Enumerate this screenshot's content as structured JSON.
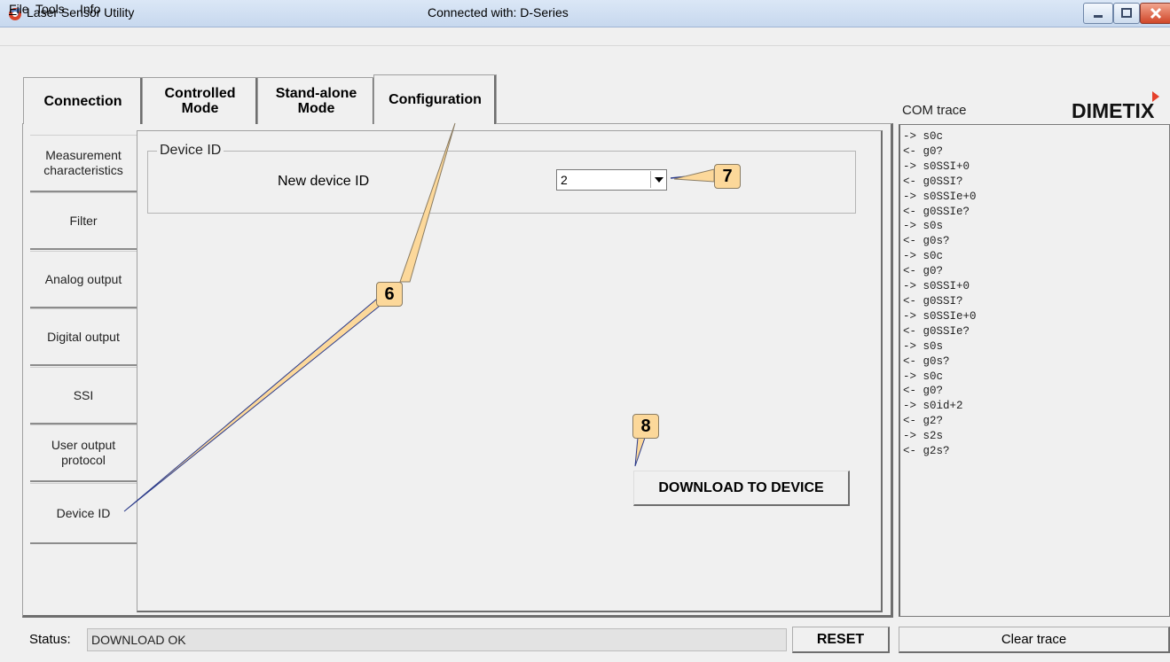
{
  "window": {
    "title": "Laser Sensor Utility",
    "connection_title": "Connected with: D-Series"
  },
  "menu": {
    "items": [
      "File",
      "Tools",
      "Info"
    ]
  },
  "tabs": [
    {
      "label_line1": "Connection",
      "label_line2": ""
    },
    {
      "label_line1": "Controlled",
      "label_line2": "Mode"
    },
    {
      "label_line1": "Stand-alone",
      "label_line2": "Mode"
    },
    {
      "label_line1": "Configuration",
      "label_line2": ""
    }
  ],
  "side_tabs": [
    {
      "line1": "Measurement",
      "line2": "characteristics"
    },
    {
      "line1": "Filter",
      "line2": ""
    },
    {
      "line1": "Analog output",
      "line2": ""
    },
    {
      "line1": "Digital output",
      "line2": ""
    },
    {
      "line1": "SSI",
      "line2": ""
    },
    {
      "line1": "User output",
      "line2": "protocol"
    },
    {
      "line1": "Device ID",
      "line2": ""
    }
  ],
  "device_id": {
    "group_title": "Device ID",
    "new_device_label": "New device ID",
    "selected_value": "2"
  },
  "download_button": "DOWNLOAD TO DEVICE",
  "com_trace": {
    "title": "COM trace",
    "logo": "DIMETIX",
    "lines": [
      "-> s0c",
      "<- g0?",
      "-> s0SSI+0",
      "<- g0SSI?",
      "-> s0SSIe+0",
      "<- g0SSIe?",
      "-> s0s",
      "<- g0s?",
      "-> s0c",
      "<- g0?",
      "-> s0SSI+0",
      "<- g0SSI?",
      "-> s0SSIe+0",
      "<- g0SSIe?",
      "-> s0s",
      "<- g0s?",
      "-> s0c",
      "<- g0?",
      "-> s0id+2",
      "<- g2?",
      "-> s2s",
      "<- g2s?"
    ],
    "clear_button": "Clear trace"
  },
  "status": {
    "label": "Status:",
    "value": "DOWNLOAD OK",
    "reset_button": "RESET"
  },
  "callouts": {
    "six": "6",
    "seven": "7",
    "eight": "8"
  },
  "colors": {
    "callout_fill": "#fcd89a",
    "logo_accent": "#e5402b",
    "logo_text": "#111111"
  }
}
